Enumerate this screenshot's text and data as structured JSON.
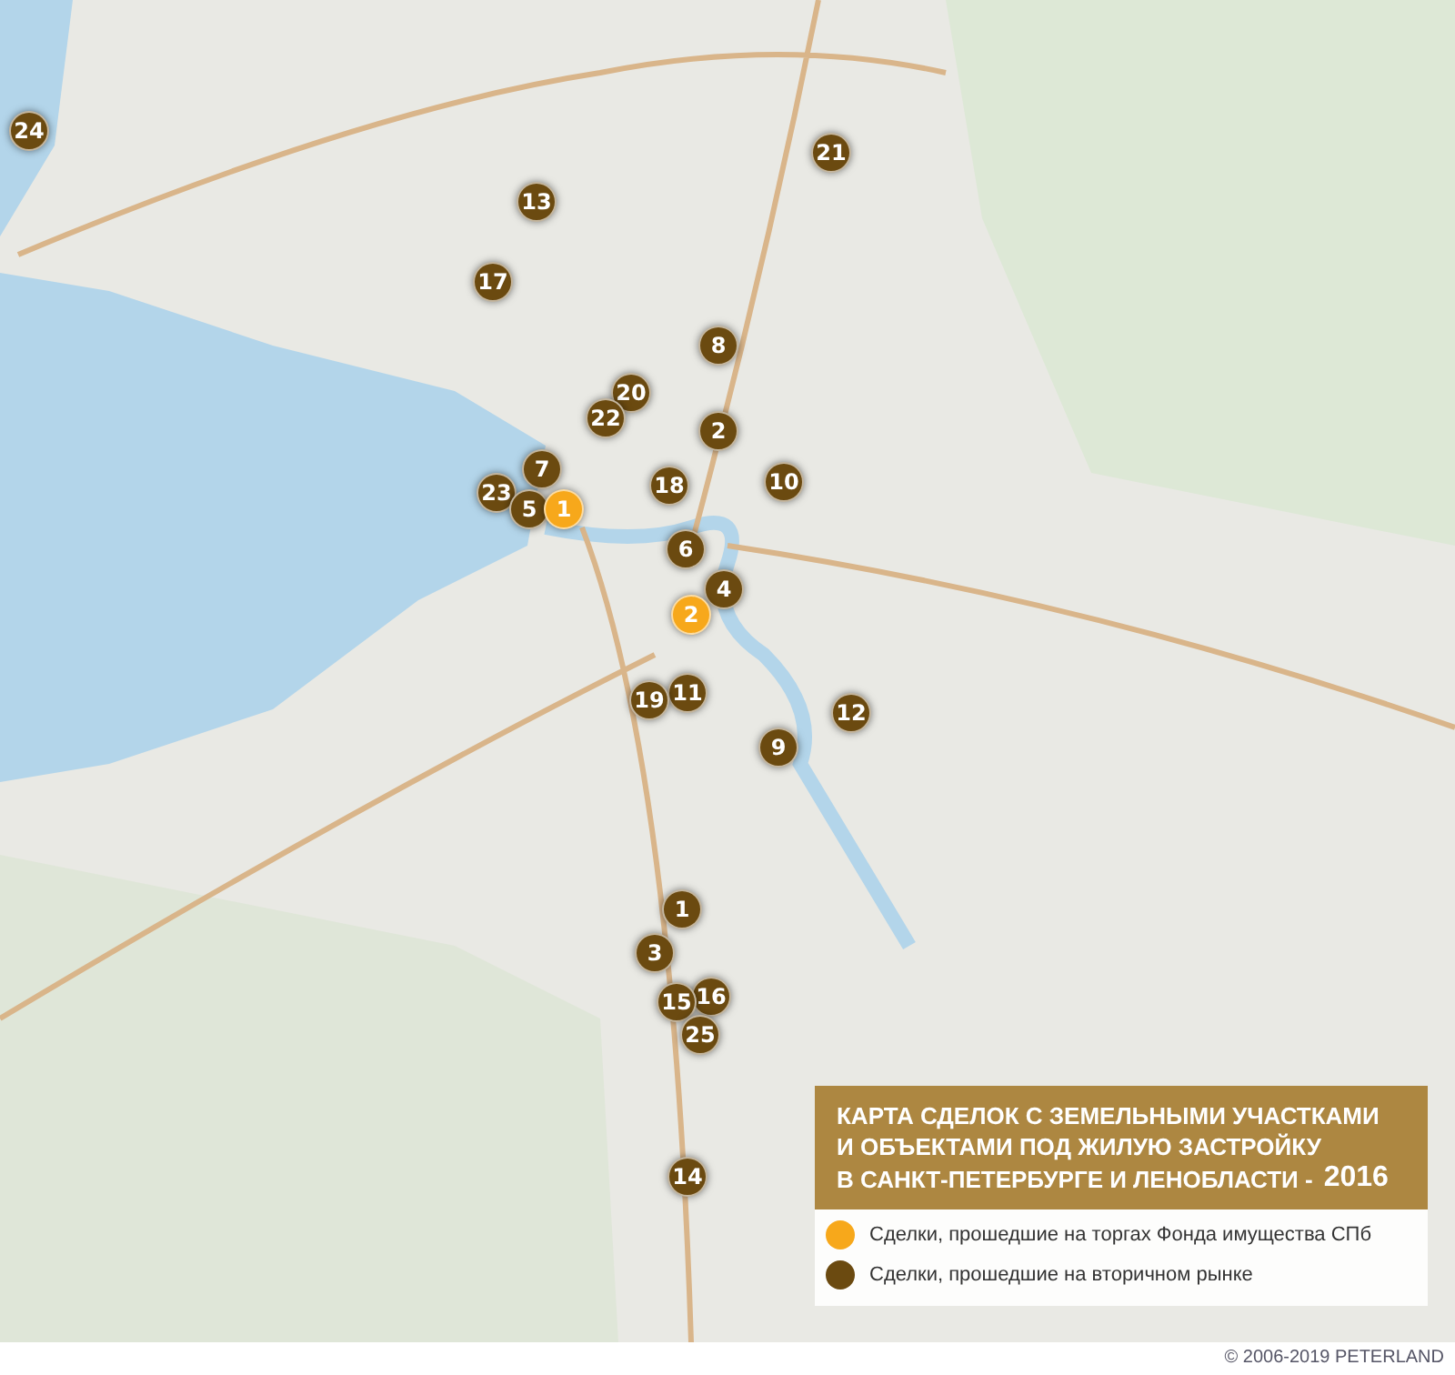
{
  "markers": [
    {
      "label": "24",
      "kind": "secondary"
    },
    {
      "label": "21",
      "kind": "secondary"
    },
    {
      "label": "13",
      "kind": "secondary"
    },
    {
      "label": "17",
      "kind": "secondary"
    },
    {
      "label": "8",
      "kind": "secondary"
    },
    {
      "label": "20",
      "kind": "secondary"
    },
    {
      "label": "22",
      "kind": "secondary"
    },
    {
      "label": "2",
      "kind": "secondary"
    },
    {
      "label": "10",
      "kind": "secondary"
    },
    {
      "label": "7",
      "kind": "secondary"
    },
    {
      "label": "18",
      "kind": "secondary"
    },
    {
      "label": "23",
      "kind": "secondary"
    },
    {
      "label": "5",
      "kind": "secondary"
    },
    {
      "label": "1",
      "kind": "auction"
    },
    {
      "label": "6",
      "kind": "secondary"
    },
    {
      "label": "4",
      "kind": "secondary"
    },
    {
      "label": "2",
      "kind": "auction"
    },
    {
      "label": "11",
      "kind": "secondary"
    },
    {
      "label": "19",
      "kind": "secondary"
    },
    {
      "label": "12",
      "kind": "secondary"
    },
    {
      "label": "9",
      "kind": "secondary"
    },
    {
      "label": "1",
      "kind": "secondary"
    },
    {
      "label": "3",
      "kind": "secondary"
    },
    {
      "label": "16",
      "kind": "secondary"
    },
    {
      "label": "15",
      "kind": "secondary"
    },
    {
      "label": "25",
      "kind": "secondary"
    },
    {
      "label": "14",
      "kind": "secondary"
    }
  ],
  "legend": {
    "title_lines": [
      "КАРТА СДЕЛОК С ЗЕМЕЛЬНЫМИ УЧАСТКАМИ",
      "И ОБЪЕКТАМИ ПОД ЖИЛУЮ ЗАСТРОЙКУ",
      "В САНКТ-ПЕТЕРБУРГЕ И ЛЕНОБЛАСТИ -"
    ],
    "year": "2016",
    "items": [
      {
        "kind": "auction",
        "label": "Сделки, прошедшие на торгах Фонда имущества СПб"
      },
      {
        "kind": "secondary",
        "label": "Сделки, прошедшие на вторичном рынке"
      }
    ]
  },
  "copyright": "© 2006-2019  PETERLAND"
}
